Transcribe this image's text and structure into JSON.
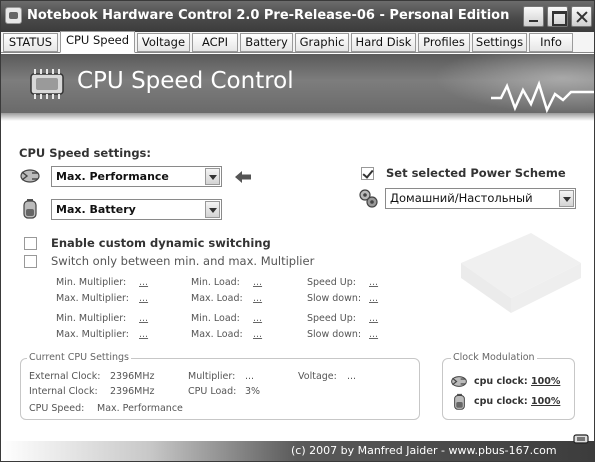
{
  "window": {
    "title": "Notebook Hardware Control 2.0 Pre-Release-06 - Personal Edition"
  },
  "tabs": [
    {
      "label": "STATUS",
      "active": false
    },
    {
      "label": "CPU Speed",
      "active": true
    },
    {
      "label": "Voltage",
      "active": false
    },
    {
      "label": "ACPI",
      "active": false
    },
    {
      "label": "Battery",
      "active": false
    },
    {
      "label": "Graphic",
      "active": false
    },
    {
      "label": "Hard Disk",
      "active": false
    },
    {
      "label": "Profiles",
      "active": false
    },
    {
      "label": "Settings",
      "active": false
    },
    {
      "label": "Info",
      "active": false
    }
  ],
  "banner": {
    "title": "CPU Speed Control",
    "icon": "cpu-chip-icon"
  },
  "cpu_speed_settings": {
    "heading": "CPU Speed settings:",
    "ac_profile": {
      "value": "Max. Performance",
      "icon": "power-plug-icon"
    },
    "battery_profile": {
      "value": "Max. Battery",
      "icon": "battery-icon"
    },
    "active_indicator_icon": "arrow-left-icon",
    "power_scheme": {
      "checkbox_label": "Set selected Power Scheme",
      "checked": true,
      "value": "Домашний/Настольный",
      "icon": "power-scheme-icon"
    },
    "custom_switching": {
      "label": "Enable custom dynamic switching",
      "checked": false
    },
    "switch_minmax": {
      "label": "Switch only between min. and max. Multiplier",
      "checked": false
    }
  },
  "multiplier_grid": {
    "labels": {
      "min_multiplier": "Min. Multiplier:",
      "max_multiplier": "Max. Multiplier:",
      "min_load": "Min. Load:",
      "max_load": "Max. Load:",
      "speed_up": "Speed Up:",
      "slow_down": "Slow down:"
    },
    "value_placeholder": "..."
  },
  "current_cpu": {
    "legend": "Current CPU Settings",
    "external_clock_label": "External Clock:",
    "external_clock_value": "2396MHz",
    "internal_clock_label": "Internal Clock:",
    "internal_clock_value": "2396MHz",
    "multiplier_label": "Multiplier:",
    "multiplier_value": "...",
    "cpu_load_label": "CPU Load:",
    "cpu_load_value": "3%",
    "voltage_label": "Voltage:",
    "voltage_value": "...",
    "cpu_speed_label": "CPU Speed:",
    "cpu_speed_value": "Max. Performance"
  },
  "clock_modulation": {
    "legend": "Clock Modulation",
    "ac": {
      "label": "cpu clock:",
      "value": "100%",
      "icon": "power-plug-icon"
    },
    "battery": {
      "label": "cpu clock:",
      "value": "100%",
      "icon": "battery-icon"
    }
  },
  "footer": {
    "text": "(c) 2007 by Manfred Jaider - www.pbus-167.com"
  }
}
